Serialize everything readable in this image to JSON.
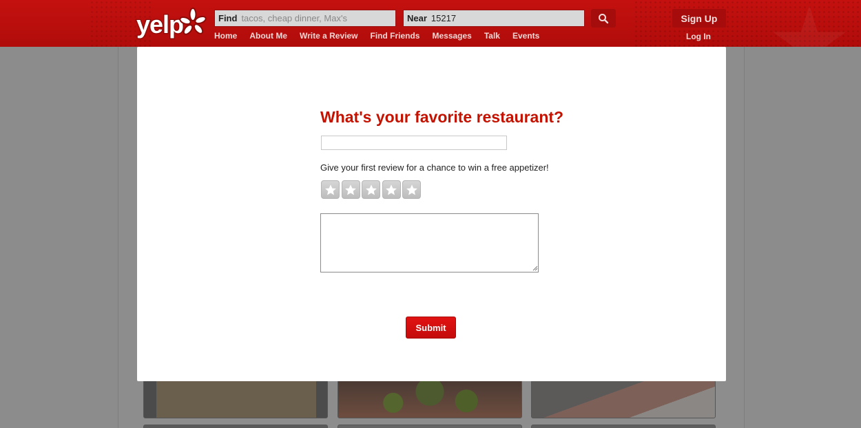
{
  "header": {
    "logo_text": "yelp",
    "search": {
      "find_label": "Find",
      "find_placeholder": "tacos, cheap dinner, Max's",
      "near_label": "Near",
      "near_value": "15217"
    },
    "nav": [
      {
        "label": "Home"
      },
      {
        "label": "About Me"
      },
      {
        "label": "Write a Review"
      },
      {
        "label": "Find Friends"
      },
      {
        "label": "Messages"
      },
      {
        "label": "Talk"
      },
      {
        "label": "Events"
      }
    ],
    "signup_label": "Sign Up",
    "login_label": "Log In"
  },
  "modal": {
    "title": "What's your favorite restaurant?",
    "restaurant_input_value": "",
    "promo_text": "Give your first review for a chance to win a free appetizer!",
    "rating": {
      "selected": 0,
      "max": 5
    },
    "review_text": "",
    "submit_label": "Submit"
  },
  "colors": {
    "brand_red": "#c41200",
    "header_red": "#b00c0a",
    "submit_red": "#d40f0f",
    "overlay_gray": "#8c8c8c"
  },
  "icons": [
    "yelp-burst-logo",
    "search-icon",
    "star-icon"
  ]
}
